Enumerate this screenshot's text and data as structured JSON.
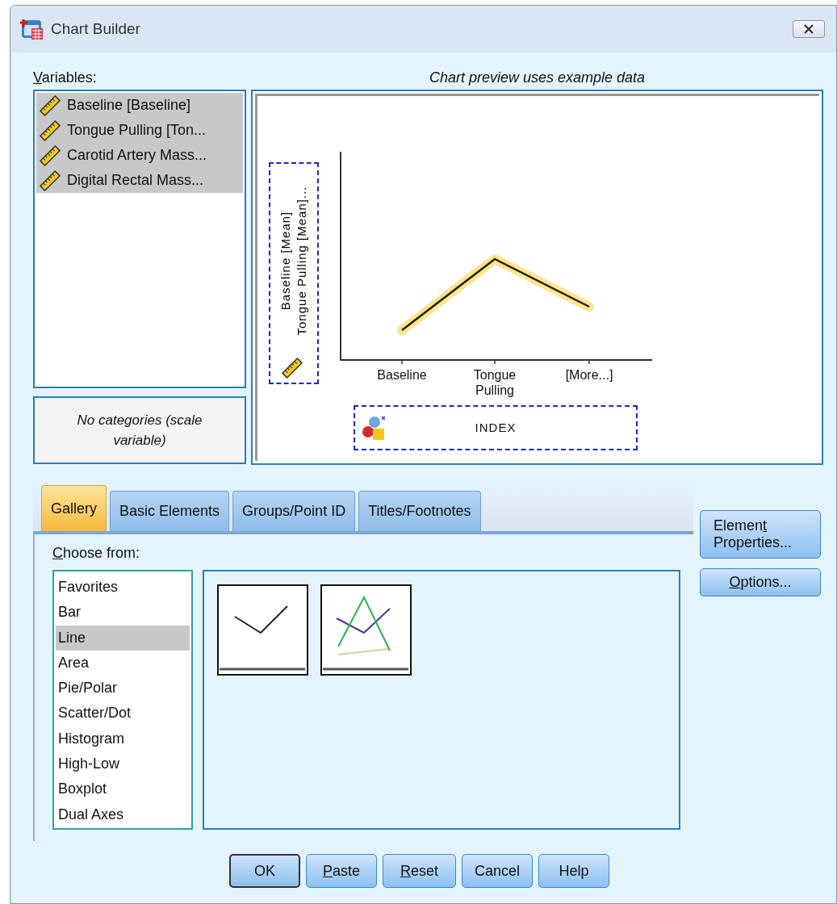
{
  "window": {
    "title": "Chart Builder"
  },
  "variables": {
    "label": [
      {
        "text": "V",
        "underlined": true
      },
      {
        "text": "ariables:",
        "underlined": false
      }
    ],
    "items": [
      {
        "text": "Baseline [Baseline]",
        "selected": true
      },
      {
        "text": "Tongue Pulling [Ton...",
        "selected": true
      },
      {
        "text": "Carotid Artery Mass...",
        "selected": true
      },
      {
        "text": "Digital Rectal Mass...",
        "selected": true
      }
    ]
  },
  "categories_note": "No categories (scale variable)",
  "preview": {
    "caption": "Chart preview uses example data",
    "y_axis_lines": [
      "Baseline [Mean]",
      "Tongue Pulling [Mean]..."
    ],
    "x_labels": [
      "Baseline",
      "Tongue Pulling",
      "[More...]"
    ],
    "x_axis_variable": "INDEX"
  },
  "tabs": [
    {
      "label": "Gallery",
      "selected": true
    },
    {
      "label": "Basic Elements",
      "selected": false
    },
    {
      "label": "Groups/Point ID",
      "selected": false
    },
    {
      "label": "Titles/Footnotes",
      "selected": false
    }
  ],
  "gallery": {
    "label": [
      {
        "text": "C",
        "underlined": true
      },
      {
        "text": "hoose from:",
        "underlined": false
      }
    ],
    "chart_types": [
      {
        "text": "Favorites",
        "selected": false
      },
      {
        "text": "Bar",
        "selected": false
      },
      {
        "text": "Line",
        "selected": true
      },
      {
        "text": "Area",
        "selected": false
      },
      {
        "text": "Pie/Polar",
        "selected": false
      },
      {
        "text": "Scatter/Dot",
        "selected": false
      },
      {
        "text": "Histogram",
        "selected": false
      },
      {
        "text": "High-Low",
        "selected": false
      },
      {
        "text": "Boxplot",
        "selected": false
      },
      {
        "text": "Dual Axes",
        "selected": false
      }
    ],
    "thumbnails": [
      {
        "kind": "simple-line"
      },
      {
        "kind": "multiple-line"
      }
    ]
  },
  "side_buttons": [
    {
      "label": [
        {
          "text": "Elemen",
          "underlined": false
        },
        {
          "text": "t",
          "underlined": true
        },
        {
          "text": " Properties...",
          "underlined": false
        }
      ]
    },
    {
      "label": [
        {
          "text": "O",
          "underlined": true
        },
        {
          "text": "ptions...",
          "underlined": false
        }
      ]
    }
  ],
  "buttons": [
    {
      "label": [
        {
          "text": "OK",
          "underlined": false
        }
      ],
      "default": true
    },
    {
      "label": [
        {
          "text": "P",
          "underlined": true
        },
        {
          "text": "aste",
          "underlined": false
        }
      ],
      "default": false
    },
    {
      "label": [
        {
          "text": "R",
          "underlined": true
        },
        {
          "text": "eset",
          "underlined": false
        }
      ],
      "default": false
    },
    {
      "label": [
        {
          "text": "Cancel",
          "underlined": false
        }
      ],
      "default": false
    },
    {
      "label": [
        {
          "text": "Help",
          "underlined": false
        }
      ],
      "default": false
    }
  ]
}
